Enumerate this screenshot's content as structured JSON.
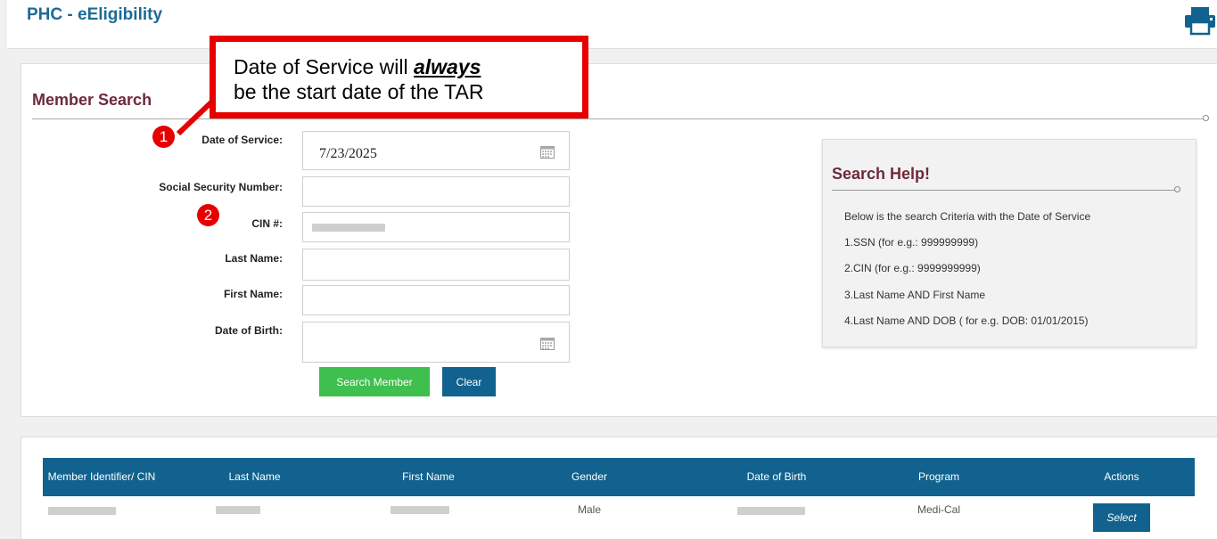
{
  "header": {
    "app_title": "PHC - eEligibility",
    "print_icon": "printer-icon"
  },
  "member_search": {
    "title": "Member Search",
    "fields": {
      "date_of_service": {
        "label": "Date of Service:",
        "value": "7/23/2025",
        "icon": "calendar-icon"
      },
      "ssn": {
        "label": "Social Security Number:",
        "value": ""
      },
      "cin": {
        "label": "CIN #:",
        "value": ""
      },
      "last_name": {
        "label": "Last Name:",
        "value": ""
      },
      "first_name": {
        "label": "First Name:",
        "value": ""
      },
      "date_of_birth": {
        "label": "Date of Birth:",
        "value": "",
        "icon": "calendar-icon"
      }
    },
    "buttons": {
      "search": "Search Member",
      "clear": "Clear"
    }
  },
  "search_help": {
    "title": "Search Help!",
    "lines": [
      "Below is the search Criteria with the Date of Service",
      "1.SSN (for e.g.: 999999999)",
      "2.CIN (for e.g.: 9999999999)",
      "3.Last Name AND First Name",
      "4.Last Name AND DOB ( for e.g. DOB: 01/01/2015)"
    ]
  },
  "annotation": {
    "line1_prefix": "Date of Service will ",
    "line1_emphasis": "always",
    "line2": "be the start date of the TAR",
    "markers": [
      "1",
      "2"
    ],
    "color": "#e60000"
  },
  "results": {
    "headers": [
      "Member Identifier/ CIN",
      "Last Name",
      "First Name",
      "Gender",
      "Date of Birth",
      "Program",
      "Actions"
    ],
    "rows": [
      {
        "gender": "Male",
        "program": "Medi-Cal",
        "action": "Select"
      }
    ]
  },
  "colors": {
    "brand_blue": "#11628e",
    "title_blue": "#1b6a97",
    "heading_maroon": "#6e2a3a",
    "search_green": "#3fbf4d"
  }
}
